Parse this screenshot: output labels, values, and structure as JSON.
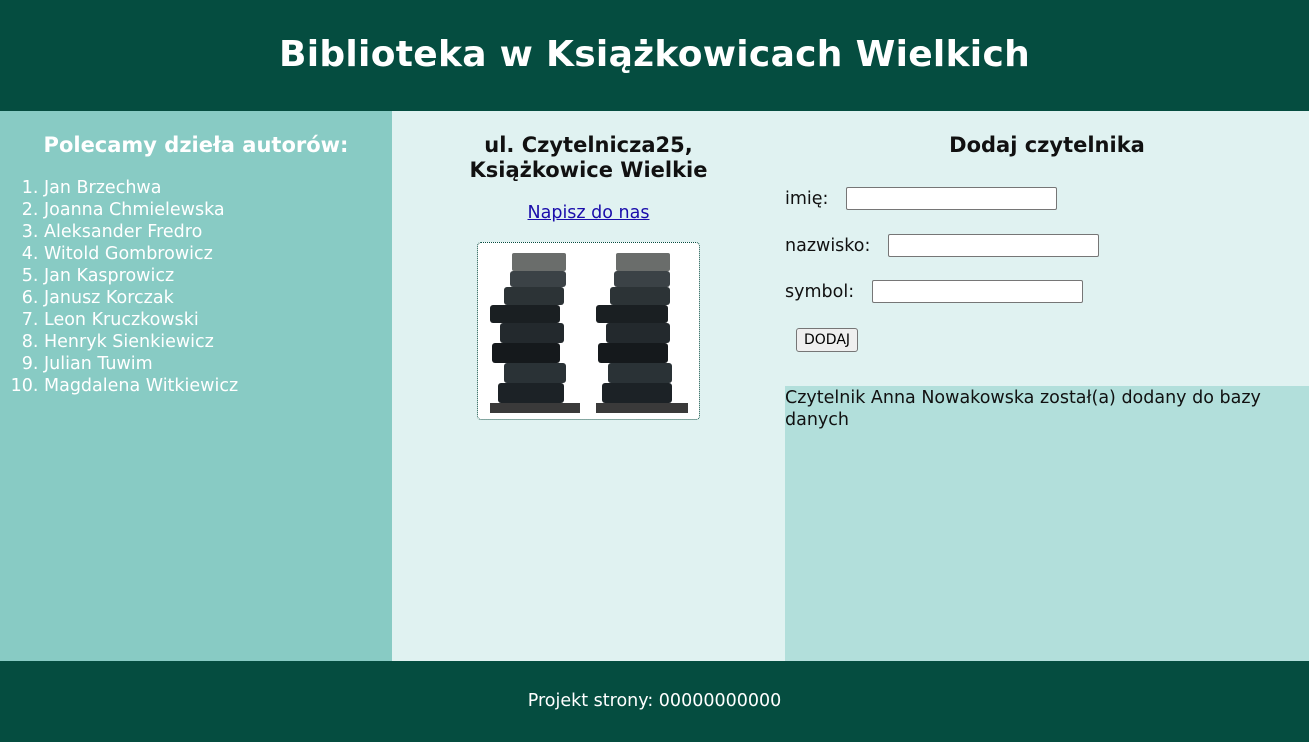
{
  "header": {
    "title": "Biblioteka w Książkowicach Wielkich"
  },
  "left": {
    "heading": "Polecamy dzieła autorów:",
    "authors": [
      "Jan Brzechwa",
      "Joanna Chmielewska",
      "Aleksander Fredro",
      "Witold Gombrowicz",
      "Jan Kasprowicz",
      "Janusz Korczak",
      "Leon Kruczkowski",
      "Henryk Sienkiewicz",
      "Julian Tuwim",
      "Magdalena Witkiewicz"
    ]
  },
  "middle": {
    "address_line1": "ul. Czytelnicza25,",
    "address_line2": "Książkowice Wielkie",
    "link": "Napisz do nas"
  },
  "form": {
    "heading": "Dodaj czytelnika",
    "imie_label": "imię:",
    "imie_value": "",
    "nazwisko_label": "nazwisko:",
    "nazwisko_value": "",
    "symbol_label": "symbol:",
    "symbol_value": "",
    "button": "DODAJ"
  },
  "result": {
    "message": "Czytelnik Anna Nowakowska został(a) dodany do bazy danych"
  },
  "footer": {
    "text": "Projekt strony: 00000000000"
  },
  "colors": {
    "header_bg": "#054d40",
    "left_bg": "#88cbc4",
    "middle_bg": "#e0f2f1",
    "result_bg": "#b2dfdb"
  }
}
